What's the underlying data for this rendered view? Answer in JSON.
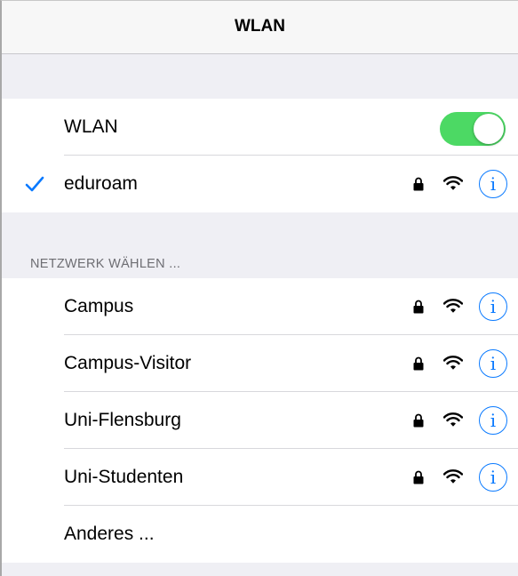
{
  "navbar": {
    "title": "WLAN"
  },
  "wlan_toggle": {
    "label": "WLAN",
    "on": true,
    "on_color": "#4cd964"
  },
  "connected": {
    "name": "eduroam",
    "secured": true,
    "check_icon": "checkmark-icon"
  },
  "section_header": "NETZWERK WÄHLEN ...",
  "networks": [
    {
      "name": "Campus",
      "secured": true
    },
    {
      "name": "Campus-Visitor",
      "secured": true
    },
    {
      "name": "Uni-Flensburg",
      "secured": true
    },
    {
      "name": "Uni-Studenten",
      "secured": true
    }
  ],
  "other": {
    "label": "Anderes ..."
  },
  "info_glyph": "i",
  "colors": {
    "accent": "#0a7aff",
    "background": "#efeff4",
    "toggle_on": "#4cd964"
  }
}
